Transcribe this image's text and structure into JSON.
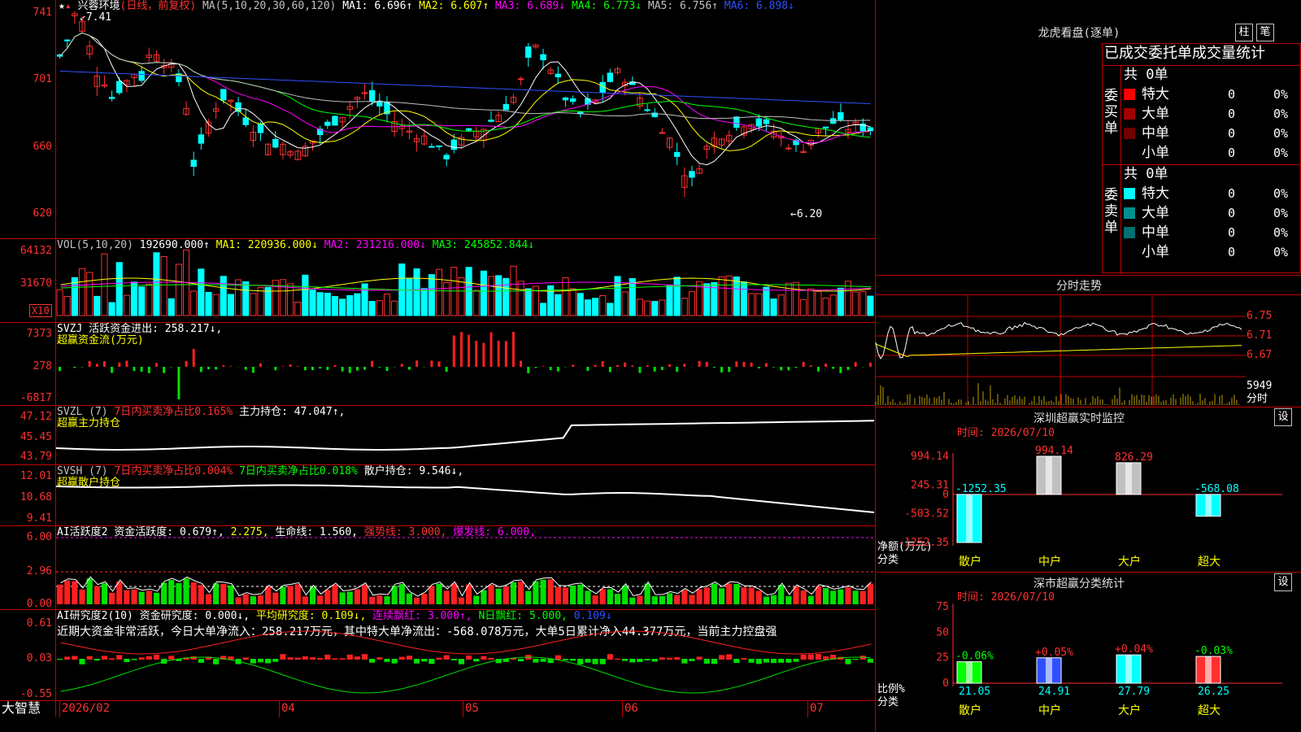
{
  "stock": {
    "name": "兴蓉环境",
    "period": "(日线，前复权)",
    "high_mark": "7.41",
    "low_mark": "6.20"
  },
  "ma_line": {
    "label": "MA(5,10,20,30,60,120)",
    "items": [
      {
        "text": "MA1: 6.696↑",
        "color": "#ffffff"
      },
      {
        "text": "MA2: 6.607↑",
        "color": "#ffff00"
      },
      {
        "text": "MA3: 6.689↓",
        "color": "#ff00ff"
      },
      {
        "text": "MA4: 6.773↓",
        "color": "#00ff00"
      },
      {
        "text": "MA5: 6.756↑",
        "color": "#c0c0c0"
      },
      {
        "text": "MA6: 6.898↓",
        "color": "#3050ff"
      }
    ]
  },
  "price_axis": [
    "741",
    "701",
    "660",
    "620"
  ],
  "vol_line": {
    "label": "VOL(5,10,20)",
    "value": "192690.000↑",
    "items": [
      {
        "text": "MA1: 220936.000↓",
        "color": "#ffff00"
      },
      {
        "text": "MA2: 231216.000↓",
        "color": "#ff00ff"
      },
      {
        "text": "MA3: 245852.844↓",
        "color": "#00ff00"
      }
    ]
  },
  "vol_axis": [
    "64132",
    "31670"
  ],
  "vol_unit": "X10",
  "svzj": {
    "label": "SVZJ  活跃资金进出: 258.217↓,",
    "sub": "超赢资金流(万元)",
    "axis": [
      "7373",
      "278",
      "-6817"
    ]
  },
  "svzl": {
    "label_parts": [
      {
        "text": "SVZL (7) ",
        "color": "#c0c0c0"
      },
      {
        "text": "7日内买卖净占比0.165%",
        "color": "#ff3030"
      },
      {
        "text": " 主力持仓: 47.047↑,",
        "color": "#ffffff"
      }
    ],
    "sub": "超赢主力持仓",
    "axis": [
      "47.12",
      "45.45",
      "43.79"
    ]
  },
  "svsh": {
    "label_parts": [
      {
        "text": "SVSH (7) ",
        "color": "#c0c0c0"
      },
      {
        "text": "7日内买卖净占比0.004%",
        "color": "#ff3030"
      },
      {
        "text": " 7日内买卖净占比0.018%",
        "color": "#00ff00"
      },
      {
        "text": " 散户持仓: 9.546↓,",
        "color": "#ffffff"
      }
    ],
    "sub": "超赢散户持仓",
    "axis": [
      "12.01",
      "10.68",
      "9.41"
    ]
  },
  "ai1": {
    "label_parts": [
      {
        "text": "AI活跃度2 资金活跃度: 0.679↑,",
        "color": "#ffffff"
      },
      {
        "text": " 2.275,",
        "color": "#ffff00"
      },
      {
        "text": " 生命线: 1.560,",
        "color": "#ffffff"
      },
      {
        "text": " 强势线: 3.000,",
        "color": "#ff3030"
      },
      {
        "text": " 爆发线: 6.000,",
        "color": "#ff00ff"
      }
    ],
    "axis": [
      "6.00",
      "2.96",
      "0.00"
    ]
  },
  "ai2": {
    "label_parts": [
      {
        "text": "AI研究度2(10) 资金研究度: 0.000↓,",
        "color": "#ffffff"
      },
      {
        "text": " 平均研究度: 0.109↓,",
        "color": "#ffff00"
      },
      {
        "text": " 连续飘红: 3.000↑,",
        "color": "#ff00ff"
      },
      {
        "text": " N日飘红: 5.000,",
        "color": "#00ff00"
      },
      {
        "text": " 0.109↓",
        "color": "#3050ff"
      }
    ],
    "note": "近期大资金非常活跃，今日大单净流入：258.217万元，其中特大单净流出：-568.078万元，大单5日累计净入44.377万元，当前主力控盘强",
    "axis": [
      "0.61",
      "0.03",
      "-0.55"
    ]
  },
  "date_axis": {
    "brand": "大智慧",
    "dates": [
      "2026/02",
      "04",
      "05",
      "06",
      "07"
    ]
  },
  "right": {
    "dragon_title": "龙虎看盘(逐单)",
    "btn_bar": "柱",
    "btn_pen": "笔",
    "stats_title": "已成交委托单成交量统计",
    "buy": {
      "vlabel": "委买单",
      "total": "共 0单",
      "rows": [
        {
          "name": "特大",
          "val": "0",
          "pct": "0%",
          "color": "#ff0000"
        },
        {
          "name": "大单",
          "val": "0",
          "pct": "0%",
          "color": "#a00000"
        },
        {
          "name": "中单",
          "val": "0",
          "pct": "0%",
          "color": "#700000"
        },
        {
          "name": "小单",
          "val": "0",
          "pct": "0%",
          "color": "#000000"
        }
      ]
    },
    "sell": {
      "vlabel": "委卖单",
      "total": "共 0单",
      "rows": [
        {
          "name": "特大",
          "val": "0",
          "pct": "0%",
          "color": "#00ffff"
        },
        {
          "name": "大单",
          "val": "0",
          "pct": "0%",
          "color": "#009090"
        },
        {
          "name": "中单",
          "val": "0",
          "pct": "0%",
          "color": "#007070"
        },
        {
          "name": "小单",
          "val": "0",
          "pct": "0%",
          "color": "#000000"
        }
      ]
    },
    "intraday": {
      "title": "分时走势",
      "axis": [
        "6.75",
        "6.71",
        "6.67"
      ],
      "vol": "5949",
      "vol_unit": "分时"
    },
    "sz_monitor": {
      "title": "深圳超赢实时监控",
      "set": "设",
      "time": "时间: 2026/07/10",
      "axis": [
        "994.14",
        "245.31",
        "0",
        "-503.52",
        "-1252.35"
      ],
      "ylabel": "净额(万元)",
      "xlabel": "分类"
    },
    "sz_stats": {
      "title": "深市超赢分类统计",
      "set": "设",
      "time": "时间: 2026/07/10",
      "axis": [
        "75",
        "50",
        "25",
        "0"
      ],
      "ylabel": "比例%",
      "xlabel": "分类"
    }
  },
  "chart_data": [
    {
      "type": "bar",
      "title": "深圳超赢实时监控",
      "categories": [
        "散户",
        "中户",
        "大户",
        "超大"
      ],
      "values": [
        -1252.35,
        994.14,
        826.29,
        -568.08
      ],
      "ylim": [
        -1252.35,
        994.14
      ]
    },
    {
      "type": "bar",
      "title": "深市超赢分类统计",
      "categories": [
        "散户",
        "中户",
        "大户",
        "超大"
      ],
      "values": [
        21.05,
        24.91,
        27.79,
        26.25
      ],
      "labels": [
        "-0.06%",
        "+0.05%",
        "+0.04%",
        "-0.03%"
      ],
      "ylim": [
        0,
        75
      ]
    }
  ]
}
